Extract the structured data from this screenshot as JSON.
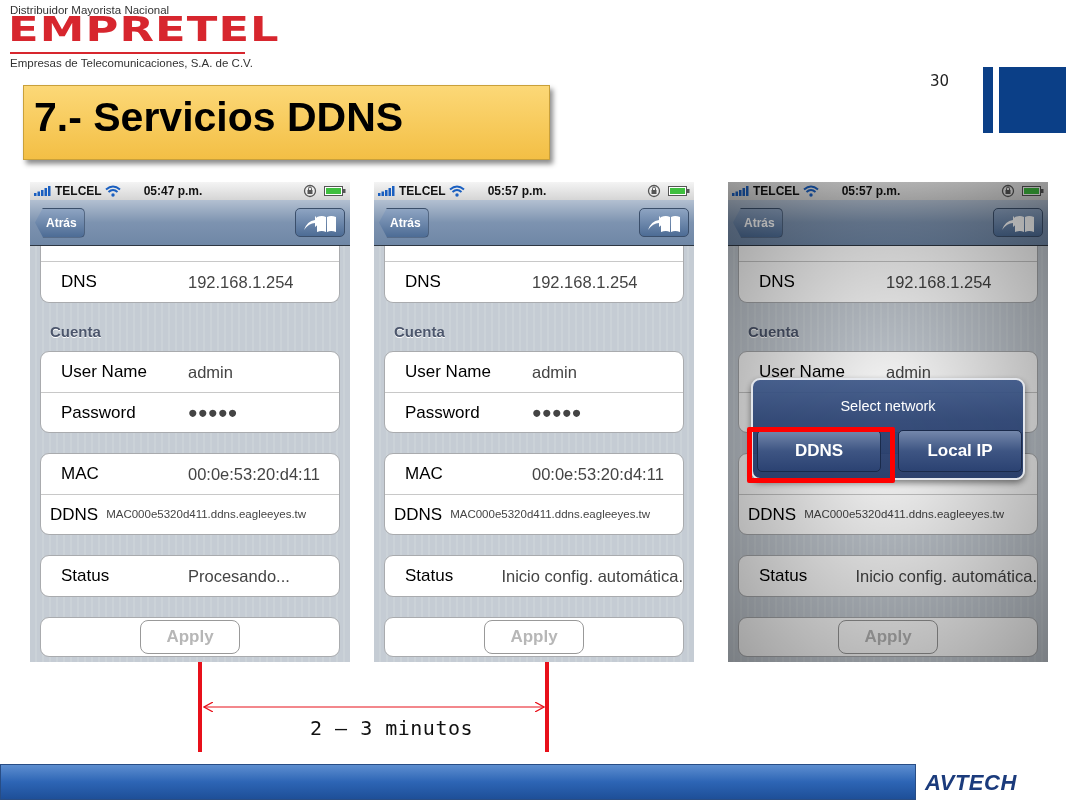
{
  "header": {
    "tagline": "Distribuidor Mayorista Nacional",
    "logo": "EMPRETEL",
    "company": "Empresas de Telecomunicaciones, S.A. de C.V."
  },
  "page_number": "30",
  "title": "7.- Servicios DDNS",
  "phones": [
    {
      "dimmed": false,
      "status_bar": {
        "carrier": "TELCEL",
        "time": "05:47 p.m."
      },
      "back_button": "Atrás",
      "groups": [
        {
          "kind": "rows",
          "clipped_top": true,
          "rows": [
            {
              "kind": "field",
              "label": "DNS",
              "value": "192.168.1.254"
            }
          ]
        },
        {
          "kind": "rows",
          "header": "Cuenta",
          "rows": [
            {
              "kind": "field",
              "label": "User Name",
              "value": "admin"
            },
            {
              "kind": "field",
              "label": "Password",
              "value": "●●●●●"
            }
          ]
        },
        {
          "kind": "rows",
          "rows": [
            {
              "kind": "field",
              "label": "MAC",
              "value": "00:0e:53:20:d4:11"
            },
            {
              "kind": "long",
              "label": "DDNS",
              "value": "MAC000e5320d411.ddns.eagleeyes.tw"
            }
          ]
        },
        {
          "kind": "rows",
          "rows": [
            {
              "kind": "field",
              "label": "Status",
              "value": "Procesando..."
            }
          ]
        },
        {
          "kind": "button",
          "label": "Apply",
          "disabled": true
        }
      ]
    },
    {
      "dimmed": false,
      "status_bar": {
        "carrier": "TELCEL",
        "time": "05:57 p.m."
      },
      "back_button": "Atrás",
      "groups": [
        {
          "kind": "rows",
          "clipped_top": true,
          "rows": [
            {
              "kind": "field",
              "label": "DNS",
              "value": "192.168.1.254"
            }
          ]
        },
        {
          "kind": "rows",
          "header": "Cuenta",
          "rows": [
            {
              "kind": "field",
              "label": "User Name",
              "value": "admin"
            },
            {
              "kind": "field",
              "label": "Password",
              "value": "●●●●●"
            }
          ]
        },
        {
          "kind": "rows",
          "rows": [
            {
              "kind": "field",
              "label": "MAC",
              "value": "00:0e:53:20:d4:11"
            },
            {
              "kind": "long",
              "label": "DDNS",
              "value": "MAC000e5320d411.ddns.eagleeyes.tw"
            }
          ]
        },
        {
          "kind": "rows",
          "rows": [
            {
              "kind": "field",
              "label": "Status",
              "value": "Inicio config. automática."
            }
          ]
        },
        {
          "kind": "button",
          "label": "Apply",
          "disabled": true
        }
      ]
    },
    {
      "dimmed": true,
      "status_bar": {
        "carrier": "TELCEL",
        "time": "05:57 p.m."
      },
      "back_button": "Atrás",
      "groups": [
        {
          "kind": "rows",
          "clipped_top": true,
          "rows": [
            {
              "kind": "field",
              "label": "DNS",
              "value": "192.168.1.254"
            }
          ]
        },
        {
          "kind": "rows",
          "header": "Cuenta",
          "rows": [
            {
              "kind": "field",
              "label": "User Name",
              "value": "admin"
            },
            {
              "kind": "field"
            }
          ]
        },
        {
          "kind": "rows",
          "rows": [
            {
              "kind": "field"
            },
            {
              "kind": "long",
              "label": "DDNS",
              "value": "MAC000e5320d411.ddns.eagleeyes.tw"
            }
          ]
        },
        {
          "kind": "rows",
          "rows": [
            {
              "kind": "field",
              "label": "Status",
              "value": "Inicio config. automática."
            }
          ]
        },
        {
          "kind": "button",
          "label": "Apply",
          "disabled": true
        }
      ],
      "alert": {
        "title": "Select network",
        "buttons": [
          {
            "label": "DDNS",
            "marked": true
          },
          {
            "label": "Local IP",
            "marked": false
          }
        ]
      }
    }
  ],
  "duration": "2 – 3 minutos",
  "footer": {
    "logo": "AVTECH"
  }
}
